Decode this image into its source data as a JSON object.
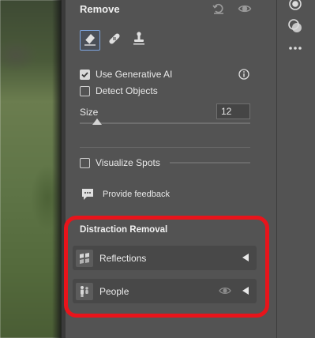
{
  "panel": {
    "title": "Remove",
    "header_icons": [
      "reset-icon",
      "visibility-eye-icon"
    ]
  },
  "tools": [
    {
      "name": "eraser-remove-tool",
      "active": true
    },
    {
      "name": "heal-bandage-tool",
      "active": false
    },
    {
      "name": "clone-stamp-tool",
      "active": false
    }
  ],
  "options": {
    "use_generative_ai": {
      "label": "Use Generative AI",
      "checked": true
    },
    "detect_objects": {
      "label": "Detect Objects",
      "checked": false
    }
  },
  "size": {
    "label": "Size",
    "value": "12",
    "slider_fraction": 0.1
  },
  "visualize_spots": {
    "label": "Visualize Spots",
    "checked": false
  },
  "feedback": {
    "label": "Provide feedback"
  },
  "distraction_removal": {
    "title": "Distraction Removal",
    "items": [
      {
        "label": "Reflections",
        "icon": "reflections-icon"
      },
      {
        "label": "People",
        "icon": "people-icon"
      }
    ]
  },
  "colors": {
    "panel_bg": "#535353",
    "accent_blue": "#7ea6e0",
    "highlight_red": "#e8141b"
  }
}
